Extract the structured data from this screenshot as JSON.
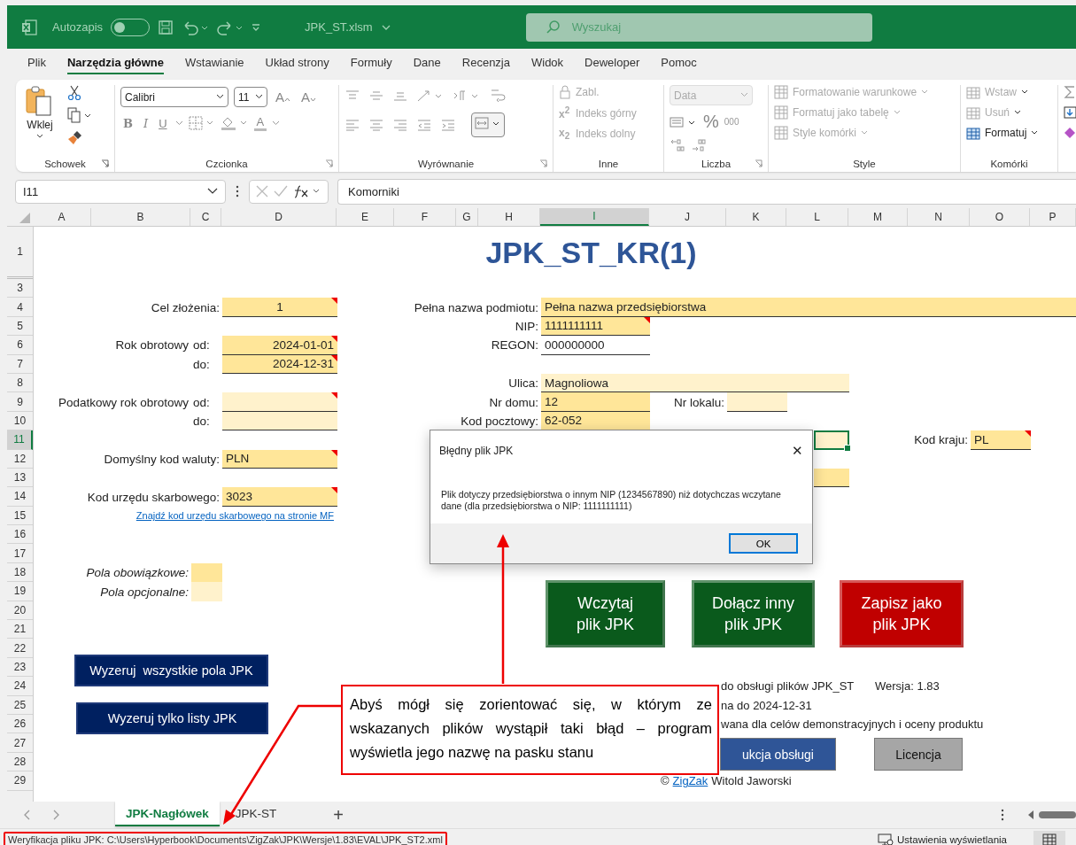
{
  "titlebar": {
    "autosave_label": "Autozapis",
    "autosave_on": false,
    "filename": "JPK_ST.xlsm",
    "search_placeholder": "Wyszukaj"
  },
  "menu_tabs": [
    {
      "label": "Plik",
      "selected": false
    },
    {
      "label": "Narzędzia główne",
      "selected": true
    },
    {
      "label": "Wstawianie",
      "selected": false
    },
    {
      "label": "Układ strony",
      "selected": false
    },
    {
      "label": "Formuły",
      "selected": false
    },
    {
      "label": "Dane",
      "selected": false
    },
    {
      "label": "Recenzja",
      "selected": false
    },
    {
      "label": "Widok",
      "selected": false
    },
    {
      "label": "Deweloper",
      "selected": false
    },
    {
      "label": "Pomoc",
      "selected": false
    }
  ],
  "ribbon": {
    "clipboard": {
      "paste": "Wklej",
      "label": "Schowek"
    },
    "font": {
      "family": "Calibri",
      "size": "11",
      "grow": "A",
      "shrink": "A",
      "bold": "B",
      "italic": "I",
      "underline": "U",
      "text_color": "A",
      "label": "Czcionka"
    },
    "alignment": {
      "label": "Wyrównanie"
    },
    "other": {
      "items": [
        {
          "label": "Zabl.",
          "disabled": true
        },
        {
          "icon_text": "x$^{2}$",
          "label": "Indeks górny",
          "disabled": true
        },
        {
          "icon_text": "x$_{2}$",
          "label": "Indeks dolny",
          "disabled": true
        }
      ],
      "label": "Inne"
    },
    "number": {
      "format": "Data",
      "percent": "%",
      "thousands": "000",
      "label": "Liczba"
    },
    "styles": {
      "items": [
        {
          "label": "Formatowanie warunkowe",
          "disabled": true
        },
        {
          "label": "Formatuj jako tabelę",
          "disabled": true
        },
        {
          "label": "Style komórki",
          "disabled": true
        }
      ],
      "label": "Style"
    },
    "cells": {
      "items": [
        {
          "label": "Wstaw",
          "disabled": true
        },
        {
          "label": "Usuń",
          "disabled": true
        },
        {
          "label": "Formatuj",
          "disabled": false
        }
      ],
      "label": "Komórki"
    }
  },
  "formula_bar": {
    "cell": "I11",
    "value": "Komorniki"
  },
  "columns": [
    {
      "label": "A",
      "selected": false
    },
    {
      "label": "B",
      "selected": false
    },
    {
      "label": "C",
      "selected": false
    },
    {
      "label": "D",
      "selected": false
    },
    {
      "label": "E",
      "selected": false
    },
    {
      "label": "F",
      "selected": false
    },
    {
      "label": "G",
      "selected": false
    },
    {
      "label": "H",
      "selected": false
    },
    {
      "label": "I",
      "selected": true
    },
    {
      "label": "J",
      "selected": false
    },
    {
      "label": "K",
      "selected": false
    },
    {
      "label": "L",
      "selected": false
    },
    {
      "label": "M",
      "selected": false
    },
    {
      "label": "N",
      "selected": false
    },
    {
      "label": "O",
      "selected": false
    },
    {
      "label": "P",
      "selected": false
    }
  ],
  "rows": [
    {
      "label": "1",
      "selected": false
    },
    {
      "label": "3",
      "selected": false
    },
    {
      "label": "4",
      "selected": false
    },
    {
      "label": "5",
      "selected": false
    },
    {
      "label": "6",
      "selected": false
    },
    {
      "label": "7",
      "selected": false
    },
    {
      "label": "8",
      "selected": false
    },
    {
      "label": "9",
      "selected": false
    },
    {
      "label": "10",
      "selected": false
    },
    {
      "label": "11",
      "selected": true
    },
    {
      "label": "12",
      "selected": false
    },
    {
      "label": "13",
      "selected": false
    },
    {
      "label": "14",
      "selected": false
    },
    {
      "label": "15",
      "selected": false
    },
    {
      "label": "16",
      "selected": false
    },
    {
      "label": "17",
      "selected": false
    },
    {
      "label": "18",
      "selected": false
    },
    {
      "label": "19",
      "selected": false
    },
    {
      "label": "20",
      "selected": false
    },
    {
      "label": "21",
      "selected": false
    },
    {
      "label": "22",
      "selected": false
    },
    {
      "label": "23",
      "selected": false
    },
    {
      "label": "24",
      "selected": false
    },
    {
      "label": "25",
      "selected": false
    },
    {
      "label": "26",
      "selected": false
    },
    {
      "label": "27",
      "selected": false
    },
    {
      "label": "28",
      "selected": false
    },
    {
      "label": "29",
      "selected": false
    }
  ],
  "sheet": {
    "title": "JPK_ST_KR(1)",
    "left_fields": [
      {
        "label": "Cel złożenia:",
        "value": "1",
        "color": "#ffe699",
        "comment": true
      },
      {
        "label": "Rok obrotowy",
        "sublabel": "od:",
        "value": "2024-01-01",
        "color": "#ffe699",
        "comment": true
      },
      {
        "sublabel": "do:",
        "value": "2024-12-31",
        "color": "#ffe699",
        "comment": true
      },
      {
        "label": "Podatkowy rok obrotowy",
        "sublabel": "od:",
        "color": "#fff2cc",
        "comment": true
      },
      {
        "sublabel": "do:",
        "color": "#fff2cc",
        "comment": false
      },
      {
        "label": "Domyślny kod waluty:",
        "value": "PLN",
        "color": "#ffe699",
        "comment": true
      },
      {
        "label": "Kod urzędu skarbowego:",
        "value": "3023",
        "color": "#ffe699",
        "comment": true
      }
    ],
    "tax_office_link": "Znajdź kod urzędu skarbowego na stronie MF",
    "legend": [
      {
        "label": "Pola obowiązkowe:",
        "color": "#ffe699"
      },
      {
        "label": "Pola opcjonalne:",
        "color": "#fff2cc"
      }
    ],
    "right_fields": [
      {
        "label": "Pełna nazwa podmiotu:",
        "value": "Pełna nazwa przedsiębiorstwa",
        "color": "#ffe699",
        "comment": false,
        "selected": false
      },
      {
        "label": "NIP:",
        "value": "1111111111",
        "color": "#ffe699",
        "comment": true,
        "selected": false
      },
      {
        "label": "REGON:",
        "value": "000000000",
        "color": "#ffffff",
        "comment": false,
        "selected": false
      },
      {
        "label": "Ulica:",
        "value": "Magnoliowa",
        "color": "#fff2cc",
        "comment": false,
        "selected": false
      },
      {
        "label": "Nr domu:",
        "value": "12",
        "color": "#ffe699",
        "comment": false,
        "selected": false
      },
      {
        "label": "Kod pocztowy:",
        "value": "62-052",
        "color": "#ffe699",
        "comment": false,
        "selected": false
      },
      {
        "color": "#fff2cc",
        "comment": false,
        "selected": true
      },
      {
        "color": "#ffe699",
        "comment": false,
        "selected": false
      }
    ],
    "side_fields": [
      {
        "label": "Nr lokalu:",
        "color": "#fff2cc",
        "comment": false
      },
      {
        "label": "Kod kraju:",
        "value": "PL",
        "color": "#ffe699",
        "comment": true
      }
    ],
    "reset_buttons": [
      "Wyzeruj  wszystkie pola JPK",
      "Wyzeruj tylko listy JPK"
    ],
    "action_buttons": [
      {
        "line1": "Wczytaj",
        "line2": "plik JPK",
        "color": "#0a5a1c"
      },
      {
        "line1": "Dołącz inny",
        "line2": "plik JPK",
        "color": "#0a5a1c"
      },
      {
        "line1": "Zapisz jako",
        "line2": "plik JPK",
        "color": "#c00000"
      }
    ],
    "info_lines": [
      "do obsługi plików JPK_ST",
      "na do 2024-12-31",
      "wana dla celów demonstracyjnych i oceny produktu"
    ],
    "version": "Wersja: 1.83",
    "bottom_buttons": [
      {
        "label": "ukcja obsługi",
        "color": "#2f5597"
      },
      {
        "label": "Licencja",
        "color": "#a6a6a6"
      }
    ],
    "copyright": {
      "symbol": "©",
      "link": "ZigZak",
      "author": "Witold Jaworski"
    }
  },
  "dialog": {
    "title": "Błędny plik JPK",
    "close": "✕",
    "message": "Plik dotyczy przedsiębiorstwa o innym NIP (1234567890) niż dotychczas wczytane dane (dla przedsiębiorstwa o NIP: 1111111111)",
    "ok": "OK"
  },
  "callout": {
    "text": "Abyś mógł się zorientować się, w którym ze wskazanych plików wystąpił taki błąd – program wyświetla jego nazwę na pasku stanu"
  },
  "sheet_tabs": [
    {
      "label": "JPK-Nagłówek",
      "selected": true
    },
    {
      "label": "JPK-ST",
      "selected": false
    }
  ],
  "sheet_tabs_add": "+",
  "status_bar": {
    "text": "Weryfikacja pliku JPK: C:\\Users\\Hyperbook\\Documents\\ZigZak\\JPK\\Wersje\\1.83\\EVAL\\JPK_ST2.xml",
    "display_settings": "Ustawienia wyświetlania"
  }
}
